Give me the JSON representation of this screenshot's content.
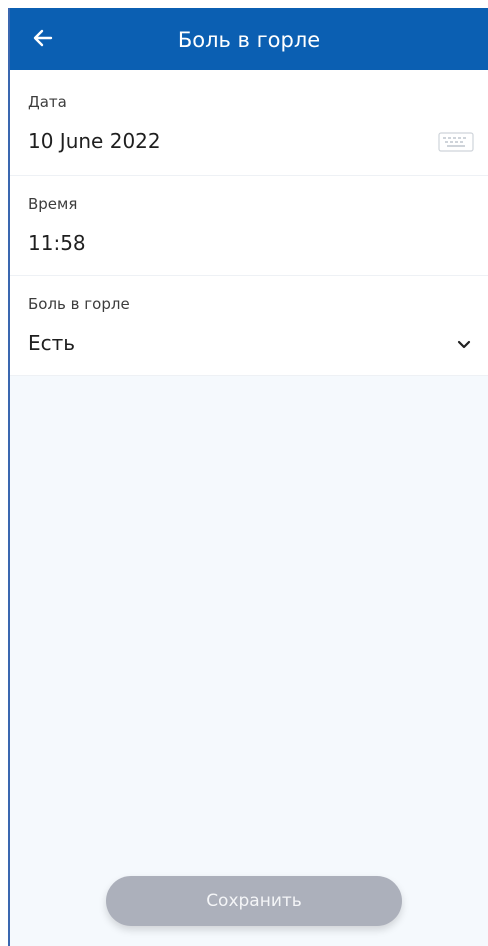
{
  "header": {
    "title": "Боль в горле",
    "back_icon": "arrow-left-icon",
    "background": "#0b5fb2"
  },
  "fields": [
    {
      "label": "Дата",
      "value": "10 June 2022",
      "icon": "keyboard-icon"
    },
    {
      "label": "Время",
      "value": "11:58"
    },
    {
      "label": "Боль в горле",
      "value": "Есть",
      "icon": "chevron-down-icon"
    }
  ],
  "footer": {
    "save_label": "Сохранить",
    "save_color": "#acb0bb"
  }
}
